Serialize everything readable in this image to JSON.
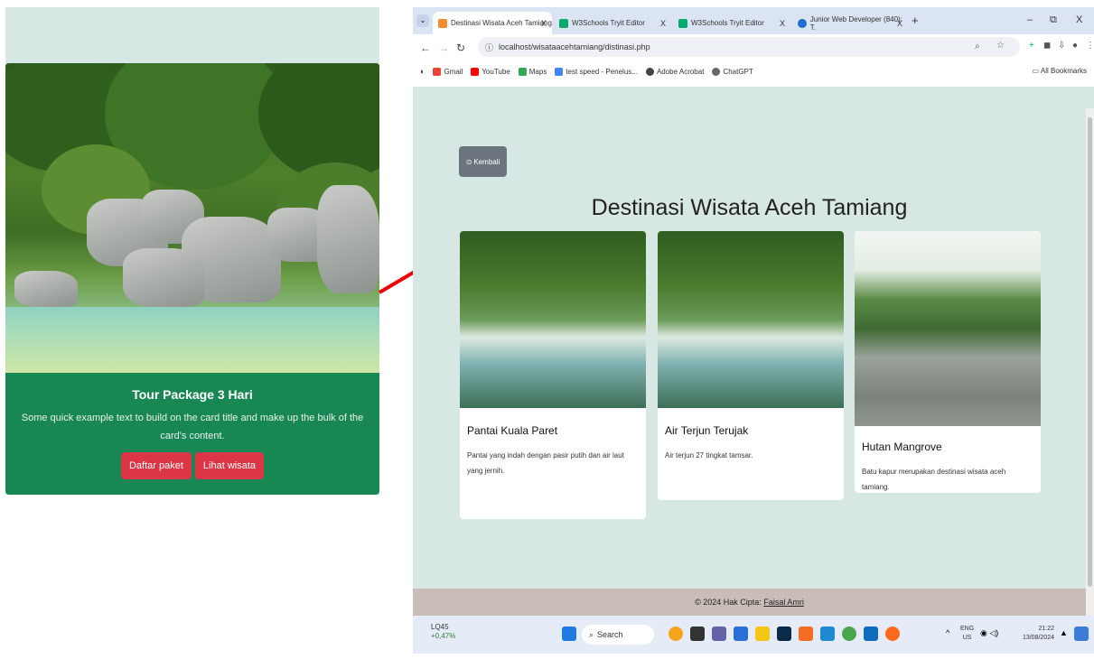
{
  "left_card": {
    "title": "Tour Package 3 Hari",
    "text": "Some quick example text to build on the card title and make up the bulk of the card's content.",
    "button1": "Daftar paket",
    "button2": "Lihat wisata"
  },
  "browser": {
    "tabs": [
      {
        "label": "Destinasi Wisata Aceh Tamiang",
        "close": "X"
      },
      {
        "label": "W3Schools Tryit Editor",
        "close": "X"
      },
      {
        "label": "W3Schools Tryit Editor",
        "close": "X"
      },
      {
        "label": "Junior Web Developer (840): T.",
        "close": "X"
      }
    ],
    "new_tab": "+",
    "window_controls": [
      "–",
      "⧉",
      "X"
    ],
    "url": "localhost/wisataacehtamiang/distinasi.php",
    "bookmarks": [
      "Gmail",
      "YouTube",
      "Maps",
      "test speed - Penelus...",
      "Adobe Acrobat",
      "ChatGPT"
    ],
    "all_bookmarks": "All Bookmarks"
  },
  "page": {
    "back_button": "Kembali",
    "title": "Destinasi Wisata Aceh Tamiang",
    "cards": [
      {
        "title": "Pantai Kuala Paret",
        "text": "Pantai yang indah dengan pasir putih dan air laut yang jernih."
      },
      {
        "title": "Air Terjun Terujak",
        "text": "Air terjun 27 tingkat tamsar."
      },
      {
        "title": "Hutan Mangrove",
        "text": "Batu kapur merupakan destinasi wisata aceh tamiang."
      }
    ],
    "footer_prefix": "© 2024 Hak Cipta:",
    "footer_author": "Faisal Amri"
  },
  "taskbar": {
    "weather_label": "LQ45",
    "weather_change": "+0,47%",
    "search": "Search",
    "lang_top": "ENG",
    "lang_bottom": "US",
    "time": "21:22",
    "date": "13/08/2024"
  },
  "colors": {
    "green": "#198754",
    "red": "#dc3545",
    "page_bg": "#d6e7e4",
    "secondary": "#6c757d"
  }
}
